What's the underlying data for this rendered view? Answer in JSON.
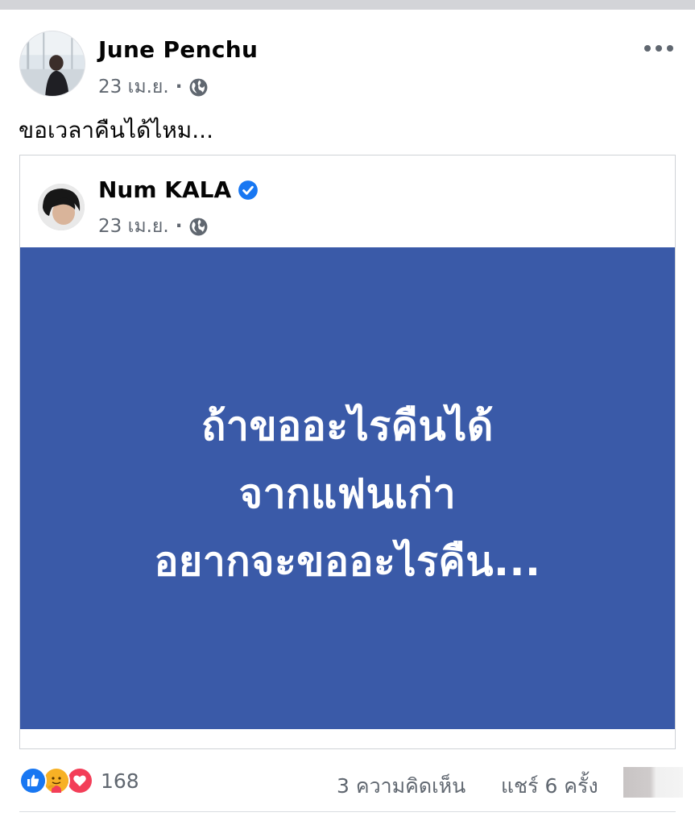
{
  "post": {
    "author": "June Penchu",
    "date": "23 เม.ย.",
    "separator": "·",
    "caption": "ขอเวลาคืนได้ไหม..."
  },
  "shared_post": {
    "author": "Num KALA",
    "date": "23 เม.ย.",
    "separator": "·",
    "status_background": "#3a5aa8",
    "status_lines": [
      "ถ้าขออะไรคืนได้",
      "จากแฟนเก่า",
      "อยากจะขออะไรคืน..."
    ]
  },
  "footer": {
    "reaction_icons": [
      "like-icon",
      "care-icon",
      "love-icon"
    ],
    "reaction_count": "168",
    "comments": "3 ความคิดเห็น",
    "shares": "แชร์ 6 ครั้ง"
  },
  "colors": {
    "brand_blue": "#1877f2",
    "love_red": "#f33e58",
    "meta_gray": "#606770"
  }
}
